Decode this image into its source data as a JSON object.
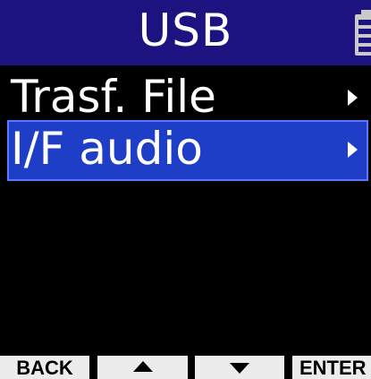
{
  "header": {
    "title": "USB",
    "battery_icon": "battery-icon"
  },
  "menu": {
    "items": [
      {
        "label": "Trasf. File",
        "icon": "chevron-right-icon",
        "selected": false
      },
      {
        "label": "I/F audio",
        "icon": "chevron-right-icon",
        "selected": true
      }
    ]
  },
  "function_bar": {
    "back_label": "BACK",
    "up_icon": "up-arrow-icon",
    "down_icon": "down-arrow-icon",
    "enter_label": "ENTER"
  },
  "colors": {
    "title_bar": "#1c1280",
    "selected_row": "#1f3ec7",
    "background": "#000000",
    "function_key": "#ececec"
  }
}
